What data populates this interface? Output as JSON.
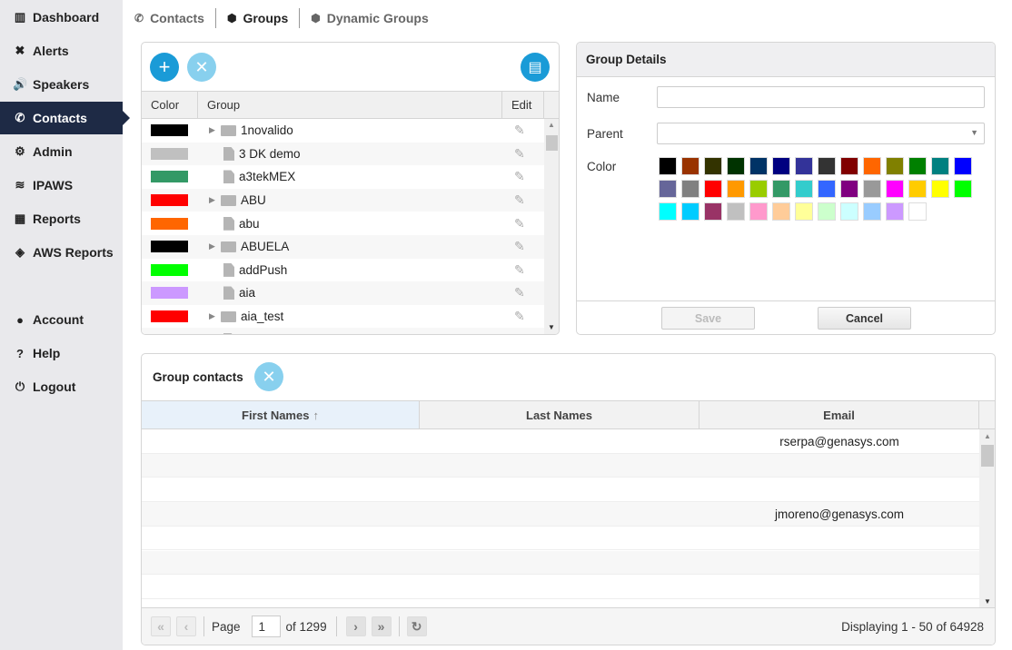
{
  "sidebar": {
    "items": [
      {
        "label": "Dashboard",
        "icon": "bar-chart-icon",
        "glyph": "▥"
      },
      {
        "label": "Alerts",
        "icon": "expand-arrows-icon",
        "glyph": "✖"
      },
      {
        "label": "Speakers",
        "icon": "volume-icon",
        "glyph": "🔊"
      },
      {
        "label": "Contacts",
        "icon": "phone-icon",
        "glyph": "✆"
      },
      {
        "label": "Admin",
        "icon": "gear-icon",
        "glyph": "⚙"
      },
      {
        "label": "IPAWS",
        "icon": "wifi-icon",
        "glyph": "≋"
      },
      {
        "label": "Reports",
        "icon": "table-icon",
        "glyph": "▦"
      },
      {
        "label": "AWS Reports",
        "icon": "cube-icon",
        "glyph": "◈"
      },
      {
        "label": "Account",
        "icon": "user-icon",
        "glyph": "●"
      },
      {
        "label": "Help",
        "icon": "question-icon",
        "glyph": "?"
      },
      {
        "label": "Logout",
        "icon": "power-icon",
        "glyph": "⏻"
      }
    ],
    "active": "Contacts"
  },
  "tabs": [
    {
      "label": "Contacts",
      "glyph": "✆"
    },
    {
      "label": "Groups",
      "glyph": "⬢"
    },
    {
      "label": "Dynamic Groups",
      "glyph": "⬢"
    }
  ],
  "groups": {
    "headers": {
      "color": "Color",
      "group": "Group",
      "edit": "Edit"
    },
    "rows": [
      {
        "name": "1novalido",
        "color": "#000000",
        "folder": true
      },
      {
        "name": "3 DK demo",
        "color": "#c0c0c0",
        "folder": false
      },
      {
        "name": "a3tekMEX",
        "color": "#339966",
        "folder": false
      },
      {
        "name": "ABU",
        "color": "#ff0000",
        "folder": true
      },
      {
        "name": "abu",
        "color": "#ff6600",
        "folder": false
      },
      {
        "name": "ABUELA",
        "color": "#000000",
        "folder": true
      },
      {
        "name": "addPush",
        "color": "#00ff00",
        "folder": false
      },
      {
        "name": "aia",
        "color": "#cc99ff",
        "folder": false
      },
      {
        "name": "aia_test",
        "color": "#ff0000",
        "folder": true
      },
      {
        "name": "",
        "color": "#ff0000",
        "folder": false
      }
    ]
  },
  "details": {
    "title": "Group Details",
    "name_label": "Name",
    "name_value": "",
    "parent_label": "Parent",
    "parent_value": "",
    "color_label": "Color",
    "save": "Save",
    "cancel": "Cancel",
    "palette": [
      "#000000",
      "#993300",
      "#333300",
      "#003300",
      "#003366",
      "#000080",
      "#333399",
      "#333333",
      "#800000",
      "#ff6600",
      "#808000",
      "#008000",
      "#008080",
      "#0000ff",
      "#666699",
      "#808080",
      "#ff0000",
      "#ff9900",
      "#99cc00",
      "#339966",
      "#33cccc",
      "#3366ff",
      "#800080",
      "#999999",
      "#ff00ff",
      "#ffcc00",
      "#ffff00",
      "#00ff00",
      "#00ffff",
      "#00ccff",
      "#993366",
      "#c0c0c0",
      "#ff99cc",
      "#ffcc99",
      "#ffff99",
      "#ccffcc",
      "#ccffff",
      "#99ccff",
      "#cc99ff",
      "#ffffff"
    ]
  },
  "contacts": {
    "title": "Group contacts",
    "headers": {
      "first": "First Names",
      "last": "Last Names",
      "email": "Email"
    },
    "rows": [
      {
        "first": "",
        "last": "",
        "email": "rserpa@genasys.com"
      },
      {
        "first": "",
        "last": "",
        "email": ""
      },
      {
        "first": "",
        "last": "",
        "email": ""
      },
      {
        "first": "",
        "last": "",
        "email": "jmoreno@genasys.com"
      },
      {
        "first": "",
        "last": "",
        "email": ""
      },
      {
        "first": "",
        "last": "",
        "email": ""
      },
      {
        "first": "",
        "last": "",
        "email": ""
      }
    ],
    "pager": {
      "page_label": "Page",
      "page": "1",
      "of": "of 1299",
      "display": "Displaying 1 - 50 of 64928"
    }
  },
  "colors": {
    "accent": "#1a9bd7",
    "accent_light": "#88d0ee",
    "sidebar_active": "#1e2a45"
  }
}
